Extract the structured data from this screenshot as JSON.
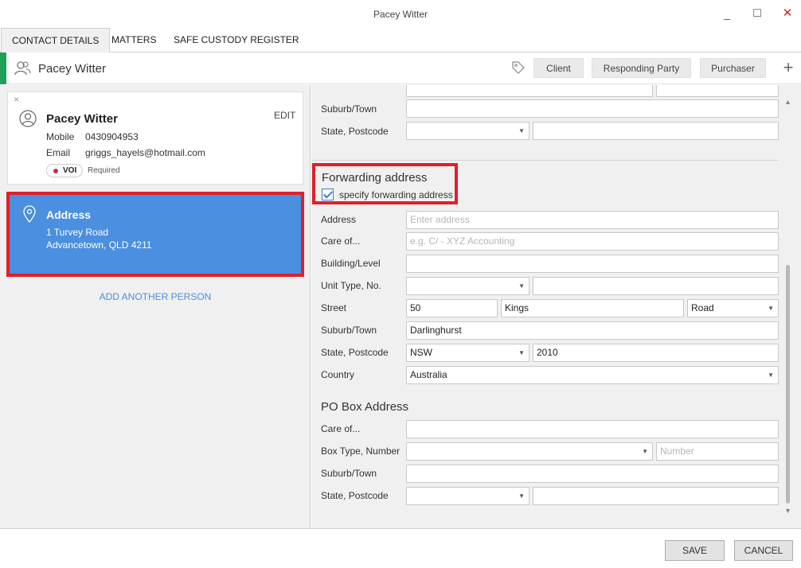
{
  "window": {
    "title": "Pacey Witter",
    "min_glyph": "_",
    "max_glyph": "☐",
    "close_glyph": "✕"
  },
  "tabs": [
    {
      "label": "CONTACT DETAILS",
      "active": true
    },
    {
      "label": "MATTERS",
      "active": false
    },
    {
      "label": "SAFE CUSTODY REGISTER",
      "active": false
    }
  ],
  "header": {
    "name": "Pacey Witter",
    "accent_color": "#1fa15a",
    "icons": [
      "people-icon",
      "tag-icon",
      "plus-icon"
    ],
    "roles": [
      "Client",
      "Responding Party",
      "Purchaser"
    ],
    "add_glyph": "+"
  },
  "contact_card": {
    "close_glyph": "×",
    "name": "Pacey Witter",
    "edit_label": "EDIT",
    "mobile_label": "Mobile",
    "mobile_value": "0430904953",
    "email_label": "Email",
    "email_value": "griggs_hayels@hotmail.com",
    "voi_label": "VOI",
    "voi_status": "Required"
  },
  "address_card": {
    "title": "Address",
    "line1": "1 Turvey Road",
    "line2": "Advancetown, QLD 4211",
    "background": "#4a8fe0"
  },
  "add_person_label": "ADD ANOTHER PERSON",
  "top_address": {
    "suburb_label": "Suburb/Town",
    "suburb_value": "",
    "state_postcode_label": "State, Postcode",
    "state_value": "",
    "postcode_value": ""
  },
  "forwarding": {
    "title": "Forwarding address",
    "checkbox_label": "specify forwarding address",
    "checked": true,
    "address_label": "Address",
    "address_placeholder": "Enter address",
    "careof_label": "Care of...",
    "careof_placeholder": "e.g. C/ - XYZ Accounting",
    "building_label": "Building/Level",
    "building_value": "",
    "unit_label": "Unit Type, No.",
    "unit_type_value": "",
    "unit_no_value": "",
    "street_label": "Street",
    "street_number": "50",
    "street_name": "Kings",
    "street_type": "Road",
    "suburb_label": "Suburb/Town",
    "suburb_value": "Darlinghurst",
    "state_postcode_label": "State, Postcode",
    "state_value": "NSW",
    "postcode_value": "2010",
    "country_label": "Country",
    "country_value": "Australia"
  },
  "po_box": {
    "title": "PO Box Address",
    "careof_label": "Care of...",
    "careof_value": "",
    "box_type_label": "Box Type, Number",
    "box_type_value": "",
    "number_placeholder": "Number",
    "suburb_label": "Suburb/Town",
    "suburb_value": "",
    "state_postcode_label": "State, Postcode",
    "state_value": "",
    "postcode_value": ""
  },
  "footer": {
    "save_label": "SAVE",
    "cancel_label": "CANCEL"
  },
  "highlight_color": "#e01f2b"
}
